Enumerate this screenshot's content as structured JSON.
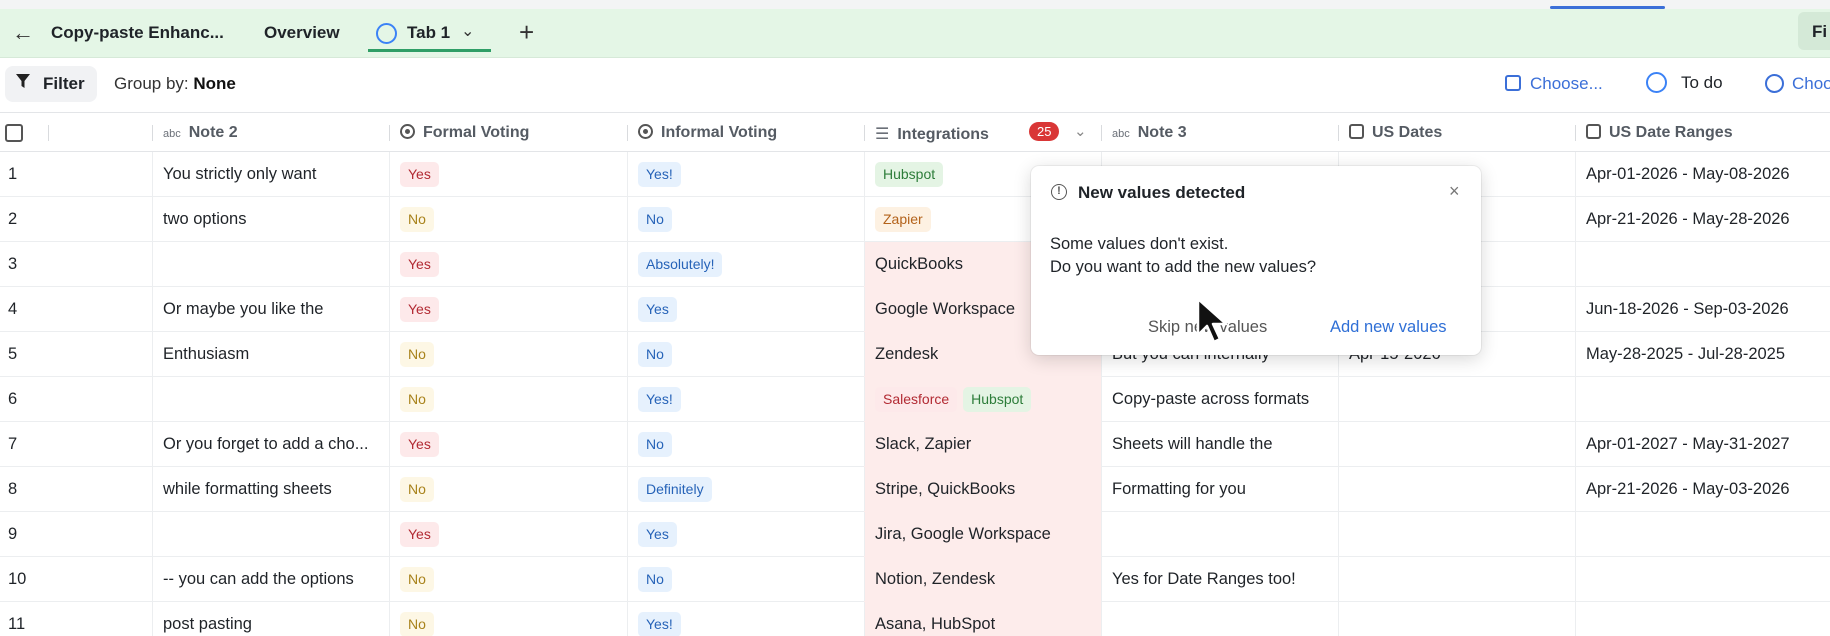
{
  "tabbar": {
    "back_icon": "arrow-left-icon",
    "breadcrumb": "Copy-paste Enhanc...",
    "overview_label": "Overview",
    "active_tab_label": "Tab 1",
    "add_tab_icon": "plus-icon",
    "right_button_label": "Fi"
  },
  "toolbar": {
    "filter_label": "Filter",
    "group_by_prefix": "Group by:",
    "group_by_value": "None",
    "choose_date_label": "Choose...",
    "status_label": "To do",
    "choose_person_label": "Choo"
  },
  "columns": [
    {
      "label": "Note 2",
      "icon": "abc-text-icon"
    },
    {
      "label": "Formal Voting",
      "icon": "single-select-icon"
    },
    {
      "label": "Informal Voting",
      "icon": "single-select-icon"
    },
    {
      "label": "Integrations",
      "icon": "multi-select-icon",
      "badge": "25"
    },
    {
      "label": "Note 3",
      "icon": "abc-text-icon"
    },
    {
      "label": "US Dates",
      "icon": "calendar-icon"
    },
    {
      "label": "US Date Ranges",
      "icon": "calendar-icon"
    }
  ],
  "rows": [
    {
      "num": "1",
      "note2": "You strictly only want",
      "formal": "Yes",
      "informal": "Yes!",
      "integrations": "",
      "note3": "",
      "usdate": "",
      "range": "Apr-01-2026 - May-08-2026"
    },
    {
      "num": "2",
      "note2": "two options",
      "formal": "No",
      "informal": "No",
      "integrations": "",
      "note3": "",
      "usdate": "",
      "range": "Apr-21-2026 - May-28-2026"
    },
    {
      "num": "3",
      "note2": "",
      "formal": "Yes",
      "informal": "Absolutely!",
      "integrations": "QuickBooks",
      "note3": "",
      "usdate": "",
      "range": ""
    },
    {
      "num": "4",
      "note2": "Or maybe you like the",
      "formal": "Yes",
      "informal": "Yes",
      "integrations": "Google Workspace",
      "note3": "",
      "usdate": "",
      "range": "Jun-18-2026 - Sep-03-2026"
    },
    {
      "num": "5",
      "note2": "Enthusiasm",
      "formal": "No",
      "informal": "No",
      "integrations": "Zendesk",
      "note3": "But you can internally",
      "usdate": "Apr-15-2026",
      "range": "May-28-2025 - Jul-28-2025"
    },
    {
      "num": "6",
      "note2": "",
      "formal": "No",
      "informal": "Yes!",
      "integrations": "",
      "note3": "Copy-paste across formats",
      "usdate": "",
      "range": ""
    },
    {
      "num": "7",
      "note2": "Or you forget to add a cho...",
      "formal": "Yes",
      "informal": "No",
      "integrations": "Slack, Zapier",
      "note3": "Sheets will handle the",
      "usdate": "",
      "range": "Apr-01-2027 - May-31-2027"
    },
    {
      "num": "8",
      "note2": "while formatting sheets",
      "formal": "No",
      "informal": "Definitely",
      "integrations": "Stripe, QuickBooks",
      "note3": "Formatting for you",
      "usdate": "",
      "range": "Apr-21-2026 - May-03-2026"
    },
    {
      "num": "9",
      "note2": "",
      "formal": "Yes",
      "informal": "Yes",
      "integrations": "Jira, Google Workspace",
      "note3": "",
      "usdate": "",
      "range": ""
    },
    {
      "num": "10",
      "note2": "-- you can add the options",
      "formal": "No",
      "informal": "No",
      "integrations": "Notion, Zendesk",
      "note3": "Yes for Date Ranges too!",
      "usdate": "",
      "range": ""
    },
    {
      "num": "11",
      "note2": "post pasting",
      "formal": "No",
      "informal": "Yes!",
      "integrations": "Asana, HubSpot",
      "note3": "",
      "usdate": "",
      "range": ""
    }
  ],
  "tag_cells": {
    "row1_integration": "Hubspot",
    "row2_integration": "Zapier",
    "row6_integration_a": "Salesforce",
    "row6_integration_b": "Hubspot"
  },
  "popup": {
    "icon": "warning-circle-icon",
    "title": "New values detected",
    "line1": "Some values don't exist.",
    "line2": "Do you want to add the new values?",
    "skip_label": "Skip new values",
    "add_label": "Add new values"
  },
  "colors": {
    "tabbar_bg": "#e4f6e6",
    "accent_blue": "#3b6fd8",
    "badge_red": "#d93636",
    "integration_bg": "#fdeceb"
  }
}
